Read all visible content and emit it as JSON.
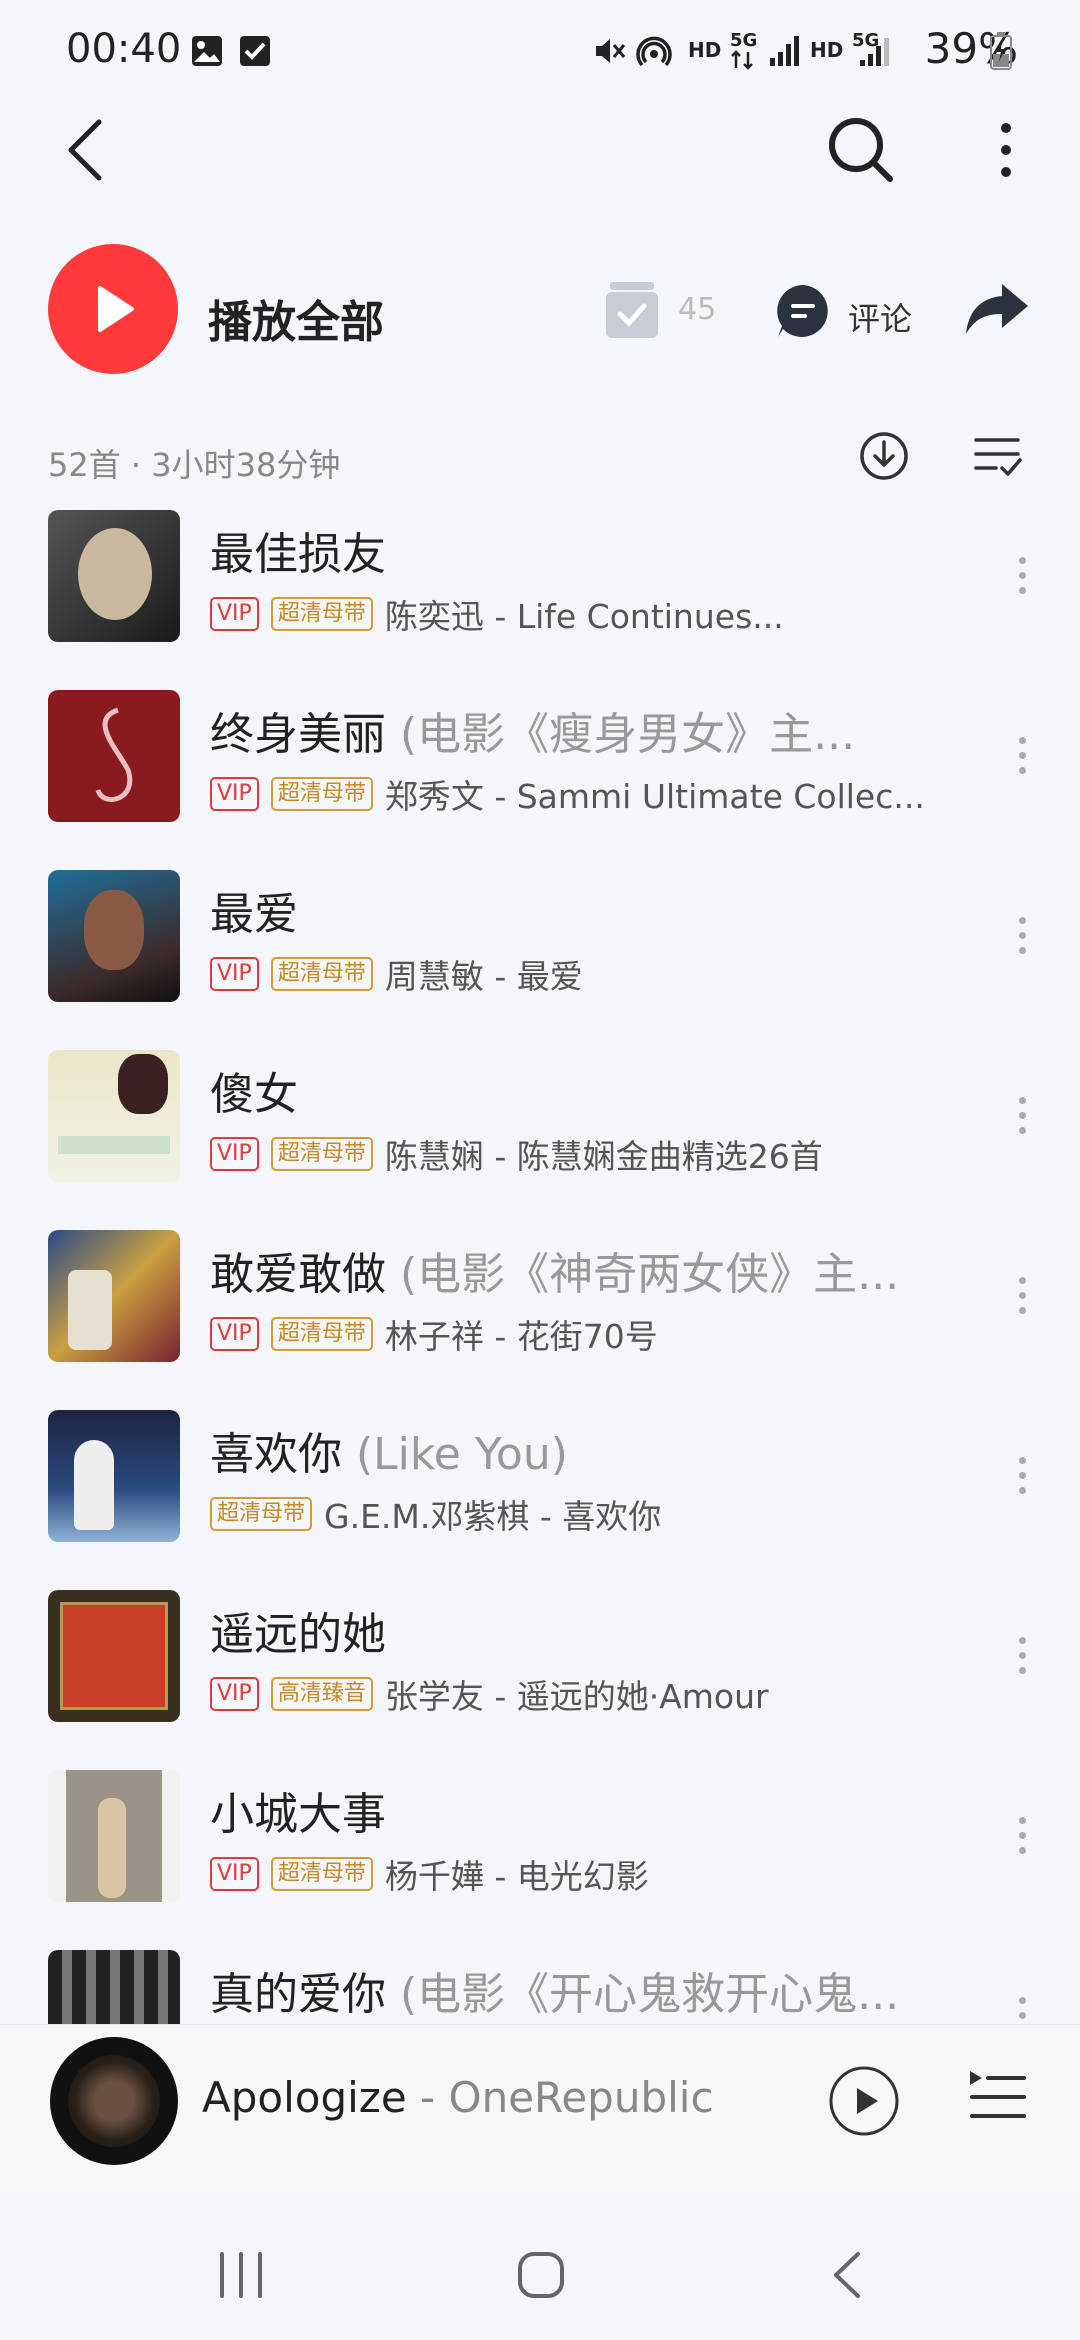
{
  "status_bar": {
    "time": "00:40",
    "battery": "39%",
    "icons": [
      "image-icon",
      "checkbox-icon",
      "mute-icon",
      "hotspot-icon",
      "hd-icon",
      "5g-icon",
      "signal-icon",
      "hd-icon",
      "5g-signal-icon",
      "battery-icon"
    ],
    "hd": "HD",
    "fiveg": "5G"
  },
  "header": {
    "icons": [
      "back-icon",
      "search-icon",
      "more-icon"
    ]
  },
  "actions": {
    "play_all": "播放全部",
    "collect_count": "45",
    "comment": "评论"
  },
  "summary": "52首 · 3小时38分钟",
  "songs": [
    {
      "title": "最佳损友",
      "subtitle": "",
      "tags": [
        {
          "text": "VIP",
          "type": "vip"
        },
        {
          "text": "超清母带",
          "type": "gold"
        }
      ],
      "artist": "陈奕迅 - Life Continues..."
    },
    {
      "title": "终身美丽",
      "subtitle": " (电影《瘦身男女》主...",
      "tags": [
        {
          "text": "VIP",
          "type": "vip"
        },
        {
          "text": "超清母带",
          "type": "gold"
        }
      ],
      "artist": "郑秀文 - Sammi Ultimate Collec..."
    },
    {
      "title": "最爱",
      "subtitle": "",
      "tags": [
        {
          "text": "VIP",
          "type": "vip"
        },
        {
          "text": "超清母带",
          "type": "gold"
        }
      ],
      "artist": "周慧敏 - 最爱"
    },
    {
      "title": "傻女",
      "subtitle": "",
      "tags": [
        {
          "text": "VIP",
          "type": "vip"
        },
        {
          "text": "超清母带",
          "type": "gold"
        }
      ],
      "artist": "陈慧娴 - 陈慧娴金曲精选26首"
    },
    {
      "title": "敢爱敢做",
      "subtitle": " (电影《神奇两女侠》主...",
      "tags": [
        {
          "text": "VIP",
          "type": "vip"
        },
        {
          "text": "超清母带",
          "type": "gold"
        }
      ],
      "artist": "林子祥 - 花街70号"
    },
    {
      "title": "喜欢你",
      "subtitle": " (Like You)",
      "tags": [
        {
          "text": "超清母带",
          "type": "gold"
        }
      ],
      "artist": "G.E.M.邓紫棋 - 喜欢你"
    },
    {
      "title": "遥远的她",
      "subtitle": "",
      "tags": [
        {
          "text": "VIP",
          "type": "vip"
        },
        {
          "text": "高清臻音",
          "type": "gold"
        }
      ],
      "artist": "张学友 - 遥远的她·Amour"
    },
    {
      "title": "小城大事",
      "subtitle": "",
      "tags": [
        {
          "text": "VIP",
          "type": "vip"
        },
        {
          "text": "超清母带",
          "type": "gold"
        }
      ],
      "artist": "杨千嬅 - 电光幻影"
    },
    {
      "title": "真的爱你",
      "subtitle": " (电影《开心鬼救开心鬼...",
      "tags": [],
      "artist": ""
    }
  ],
  "mini_player": {
    "song": "Apologize",
    "separator": " - ",
    "artist": "OneRepublic"
  },
  "colors": {
    "accent_red": "#ff3a3a",
    "vip_red": "#e0393e",
    "gold": "#c58a25",
    "background": "#f5f6fa"
  }
}
